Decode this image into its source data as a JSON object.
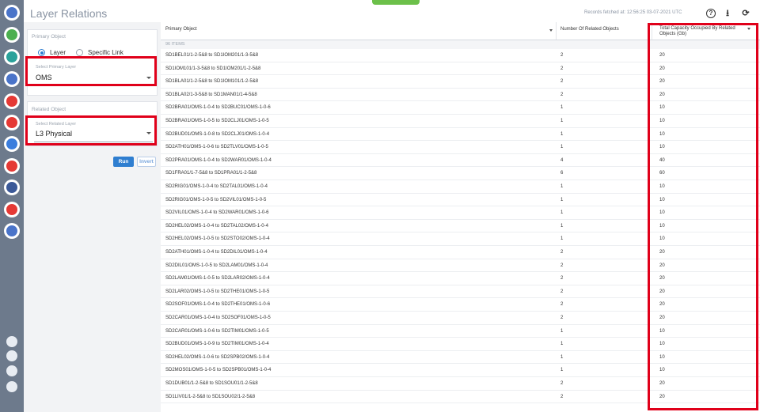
{
  "page": {
    "title": "Layer Relations",
    "records_fetched": "Records fetched at: 12:56:25 03-07-2021 UTC"
  },
  "toolbar": {
    "help_glyph": "?",
    "download_glyph": "⭳",
    "refresh_glyph": "⟳"
  },
  "sidebar": {
    "icons": [
      {
        "name": "network-globe-icon",
        "color": "#4a74c9"
      },
      {
        "name": "green-app-icon",
        "color": "#4caf50"
      },
      {
        "name": "teal-app-icon",
        "color": "#2aa29b"
      },
      {
        "name": "blue-globe-icon",
        "color": "#4a74c9"
      },
      {
        "name": "red-layers-icon",
        "color": "#e53935"
      },
      {
        "name": "red-graph-icon",
        "color": "#e53935"
      },
      {
        "name": "blue-wave-icon",
        "color": "#3b7ddd"
      },
      {
        "name": "red-map-icon",
        "color": "#e53935"
      },
      {
        "name": "smq-icon",
        "color": "#3b5998"
      },
      {
        "name": "red-search-icon",
        "color": "#e53935"
      },
      {
        "name": "layers-icon",
        "color": "#4a74c9"
      }
    ],
    "bottom_icons": [
      "info-icon",
      "gear-icon",
      "user-icon",
      "theme-icon"
    ]
  },
  "primary": {
    "title": "Primary Object",
    "radio_layer": "Layer",
    "radio_specific": "Specific Link",
    "select_label": "Select Primary Layer",
    "select_value": "OMS"
  },
  "related": {
    "title": "Related Object",
    "select_label": "Select Related Layer",
    "select_value": "L3 Physical"
  },
  "actions": {
    "run": "Run",
    "invert": "Invert"
  },
  "table": {
    "headers": {
      "primary": "Primary Object",
      "count": "Number Of Related Objects",
      "capacity": "Total Capacity Occupied By Related Objects (Gb)"
    },
    "items_label": "96 ITEMS",
    "rows": [
      {
        "obj": "SD1BEL01/1-2-5&8 to SD1IOM201/1-3-5&8",
        "count": "2",
        "cap": "20"
      },
      {
        "obj": "SD1IOM101/1-3-5&8 to SD1IOM201/1-2-5&8",
        "count": "2",
        "cap": "20"
      },
      {
        "obj": "SD1BLA01/1-2-5&8 to SD1IOM101/1-2-5&8",
        "count": "2",
        "cap": "20"
      },
      {
        "obj": "SD1BLA02/1-3-5&8 to SD1MAN01/1-4-5&8",
        "count": "2",
        "cap": "20"
      },
      {
        "obj": "SD2BRA01/OMS-1-0-4 to SD2BUC01/OMS-1-0-6",
        "count": "1",
        "cap": "10"
      },
      {
        "obj": "SD2BRA01/OMS-1-0-5 to SD2CLJ01/OMS-1-0-5",
        "count": "1",
        "cap": "10"
      },
      {
        "obj": "SD2BUD01/OMS-1-0-8 to SD2CLJ01/OMS-1-0-4",
        "count": "1",
        "cap": "10"
      },
      {
        "obj": "SD2ATH01/OMS-1-0-6 to SD2TLV01/OMS-1-0-5",
        "count": "1",
        "cap": "10"
      },
      {
        "obj": "SD2PRA01/OMS-1-0-4 to SD2WAR01/OMS-1-0-4",
        "count": "4",
        "cap": "40"
      },
      {
        "obj": "SD1FRA01/1-7-5&8 to SD1PRA01/1-2-5&8",
        "count": "6",
        "cap": "60"
      },
      {
        "obj": "SD2RIG01/OMS-1-0-4 to SD2TAL01/OMS-1-0-4",
        "count": "1",
        "cap": "10"
      },
      {
        "obj": "SD2RIG01/OMS-1-0-5 to SD2VIL01/OMS-1-0-5",
        "count": "1",
        "cap": "10"
      },
      {
        "obj": "SD2VIL01/OMS-1-0-4 to SD2WAR01/OMS-1-0-6",
        "count": "1",
        "cap": "10"
      },
      {
        "obj": "SD2HEL02/OMS-1-0-4 to SD2TAL02/OMS-1-0-4",
        "count": "1",
        "cap": "10"
      },
      {
        "obj": "SD2HEL02/OMS-1-0-5 to SD2STO02/OMS-1-0-4",
        "count": "1",
        "cap": "10"
      },
      {
        "obj": "SD2ATH01/OMS-1-0-4 to SD2DIL01/OMS-1-0-4",
        "count": "2",
        "cap": "20"
      },
      {
        "obj": "SD2DIL01/OMS-1-0-5 to SD2LAM01/OMS-1-0-4",
        "count": "2",
        "cap": "20"
      },
      {
        "obj": "SD2LAM01/OMS-1-0-5 to SD2LAR02/OMS-1-0-4",
        "count": "2",
        "cap": "20"
      },
      {
        "obj": "SD2LAR02/OMS-1-0-5 to SD2THE01/OMS-1-0-5",
        "count": "2",
        "cap": "20"
      },
      {
        "obj": "SD2SOF01/OMS-1-0-4 to SD2THE01/OMS-1-0-6",
        "count": "2",
        "cap": "20"
      },
      {
        "obj": "SD2CAR01/OMS-1-0-4 to SD2SOF01/OMS-1-0-5",
        "count": "2",
        "cap": "20"
      },
      {
        "obj": "SD2CAR01/OMS-1-0-6 to SD2TIM01/OMS-1-0-5",
        "count": "1",
        "cap": "10"
      },
      {
        "obj": "SD2BUD01/OMS-1-0-9 to SD2TIM01/OMS-1-0-4",
        "count": "1",
        "cap": "10"
      },
      {
        "obj": "SD2HEL02/OMS-1-0-6 to SD2SPB02/OMS-1-0-4",
        "count": "1",
        "cap": "10"
      },
      {
        "obj": "SD2MOS01/OMS-1-0-5 to SD2SPB01/OMS-1-0-4",
        "count": "1",
        "cap": "10"
      },
      {
        "obj": "SD1DUB01/1-2-5&8 to SD1SOU01/1-2-5&8",
        "count": "2",
        "cap": "20"
      },
      {
        "obj": "SD1LIV01/1-2-5&8 to SD1SOU02/1-2-5&8",
        "count": "2",
        "cap": "20"
      }
    ]
  }
}
